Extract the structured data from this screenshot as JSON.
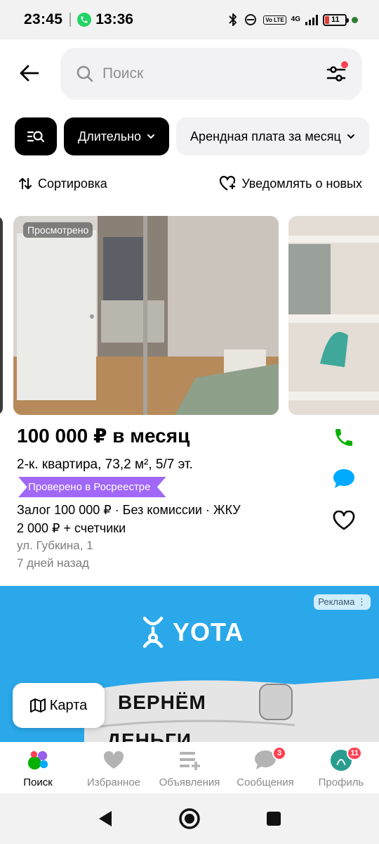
{
  "status_bar": {
    "time": "23:45",
    "call_time": "13:36",
    "volte": "Vo LTE",
    "network": "4G",
    "battery": "11"
  },
  "search": {
    "placeholder": "Поиск"
  },
  "chips": {
    "duration": "Длительно",
    "rent": "Арендная плата за месяц"
  },
  "sort": {
    "label": "Сортировка",
    "notify": "Уведомлять о новых"
  },
  "listing": {
    "viewed_badge": "Просмотрено",
    "price": "100 000 ₽ в месяц",
    "subtitle": "2-к. квартира, 73,2 м², 5/7 эт.",
    "verified": "Проверено в Росреестре",
    "terms": "Залог 100 000 ₽ · Без комиссии · ЖКУ 2 000 ₽ + счетчики",
    "address": "ул. Губкина, 1",
    "date": "7 дней назад"
  },
  "ad": {
    "label": "Реклама ⋮",
    "brand": "YOTA",
    "text_line1": "ВЕРНЁМ",
    "text_line2": "ДЕНЬГИ"
  },
  "map_button": "Карта",
  "tabs": [
    {
      "label": "Поиск",
      "icon": "search-dots-icon",
      "active": true
    },
    {
      "label": "Избранное",
      "icon": "heart-icon"
    },
    {
      "label": "Объявления",
      "icon": "listings-icon"
    },
    {
      "label": "Сообщения",
      "icon": "chat-icon",
      "badge": "3"
    },
    {
      "label": "Профиль",
      "icon": "profile-icon",
      "badge": "11"
    }
  ],
  "colors": {
    "accent_green": "#04b000",
    "accent_blue": "#00aaff",
    "badge_purple": "#a168f7",
    "badge_red": "#ff4053",
    "ad_blue": "#2aa8ea"
  }
}
